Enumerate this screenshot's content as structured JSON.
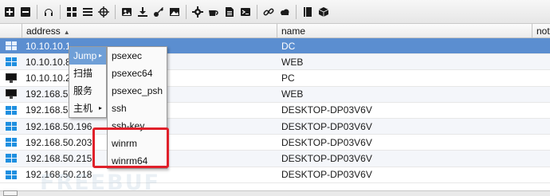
{
  "toolbar": {
    "buttons": [
      "add-icon",
      "remove-icon",
      "headphones-icon",
      "grid-icon",
      "list-icon",
      "crosshair-icon",
      "image-icon",
      "download-icon",
      "key-icon",
      "picture-icon",
      "gear-icon",
      "coffee-icon",
      "document-icon",
      "terminal-icon",
      "link-icon",
      "cloud-icon",
      "book-icon",
      "cube-icon"
    ]
  },
  "table": {
    "columns": {
      "address": "address",
      "name": "name",
      "note": "note"
    },
    "rows": [
      {
        "address": "10.10.10.1",
        "name": "DC",
        "os": "windows",
        "selected": true
      },
      {
        "address": "10.10.10.8",
        "name": "WEB",
        "os": "windows"
      },
      {
        "address": "10.10.10.2",
        "name": "PC",
        "os": "monitor"
      },
      {
        "address": "192.168.5",
        "name": "WEB",
        "os": "monitor"
      },
      {
        "address": "192.168.5",
        "name": "DESKTOP-DP03V6V",
        "os": "windows"
      },
      {
        "address": "192.168.50.196",
        "name": "DESKTOP-DP03V6V",
        "os": "windows"
      },
      {
        "address": "192.168.50.203",
        "name": "DESKTOP-DP03V6V",
        "os": "windows"
      },
      {
        "address": "192.168.50.215",
        "name": "DESKTOP-DP03V6V",
        "os": "windows"
      },
      {
        "address": "192.168.50.218",
        "name": "DESKTOP-DP03V6V",
        "os": "windows"
      }
    ]
  },
  "context_menu": {
    "items": [
      "Jump",
      "扫描",
      "服务",
      "主机"
    ]
  },
  "jump_submenu": {
    "items": [
      "psexec",
      "psexec64",
      "psexec_psh",
      "ssh",
      "ssh-key",
      "winrm",
      "winrm64"
    ]
  },
  "watermark": "FREEBUF",
  "colors": {
    "selection": "#5b8ed0",
    "menu_active": "#6f9fd7",
    "highlight": "#e0202a",
    "windows_icon": "#1e8fe0"
  }
}
